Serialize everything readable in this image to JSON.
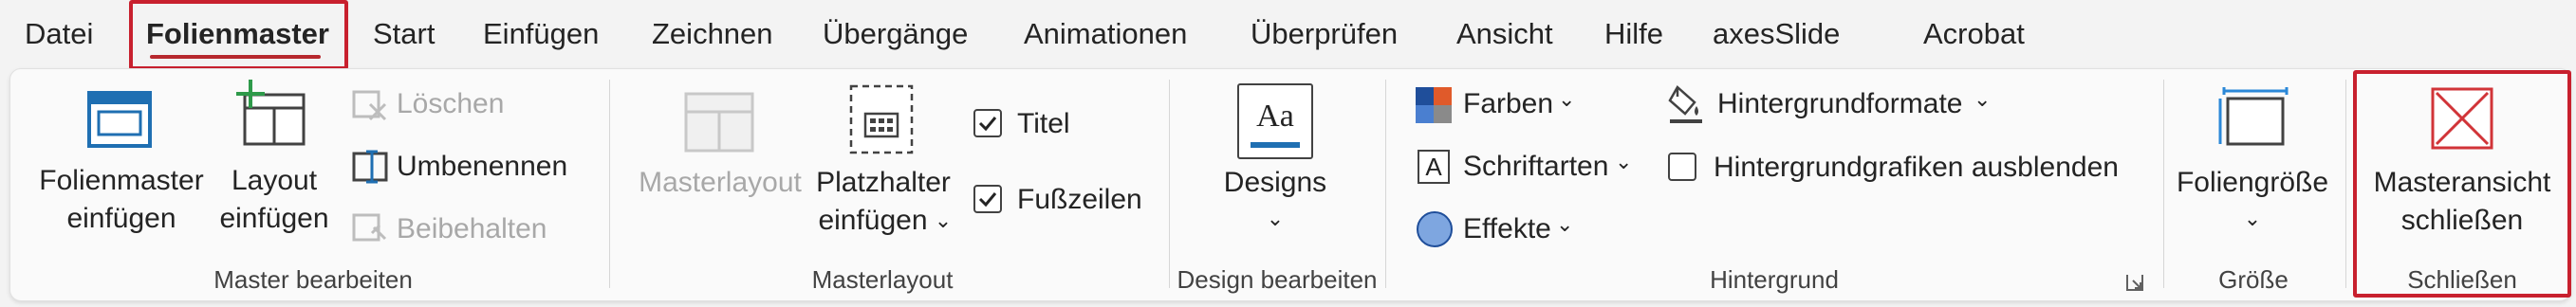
{
  "tabs": [
    {
      "label": "Datei"
    },
    {
      "label": "Folienmaster"
    },
    {
      "label": "Start"
    },
    {
      "label": "Einfügen"
    },
    {
      "label": "Zeichnen"
    },
    {
      "label": "Übergänge"
    },
    {
      "label": "Animationen"
    },
    {
      "label": "Überprüfen"
    },
    {
      "label": "Ansicht"
    },
    {
      "label": "Hilfe"
    },
    {
      "label": "axesSlide"
    },
    {
      "label": "Acrobat"
    }
  ],
  "active_tab": "Folienmaster",
  "groups": {
    "master_bearbeiten": {
      "label": "Master bearbeiten",
      "folienmaster_einfuegen": {
        "line1": "Folienmaster",
        "line2": "einfügen"
      },
      "layout_einfuegen": {
        "line1": "Layout",
        "line2": "einfügen"
      },
      "loeschen": "Löschen",
      "umbenennen": "Umbenennen",
      "beibehalten": "Beibehalten"
    },
    "masterlayout": {
      "label": "Masterlayout",
      "masterlayout_btn": "Masterlayout",
      "platzhalter": {
        "line1": "Platzhalter",
        "line2": "einfügen"
      },
      "titel": {
        "label": "Titel",
        "checked": true
      },
      "fusszeilen": {
        "label": "Fußzeilen",
        "checked": true
      }
    },
    "design_bearbeiten": {
      "label": "Design bearbeiten",
      "designs": "Designs",
      "designs_icon_text": "Aa"
    },
    "hintergrund": {
      "label": "Hintergrund",
      "farben": "Farben",
      "schriftarten": "Schriftarten",
      "schriftarten_icon_text": "A",
      "effekte": "Effekte",
      "hintergrundformate": "Hintergrundformate",
      "hintergrundgrafiken": {
        "label": "Hintergrundgrafiken ausblenden",
        "checked": false
      }
    },
    "groesse": {
      "label": "Größe",
      "foliengroesse": "Foliengröße"
    },
    "schliessen": {
      "label": "Schließen",
      "masteransicht": {
        "line1": "Masteransicht",
        "line2": "schließen"
      }
    }
  },
  "glyphs": {
    "chevron": "⌄",
    "check": "✓"
  },
  "colors": {
    "accent": "#b7282e",
    "highlight": "#c8202e",
    "icon_blue": "#1f6fb2",
    "close_red": "#d13438",
    "disabled": "#a8a8a8"
  }
}
